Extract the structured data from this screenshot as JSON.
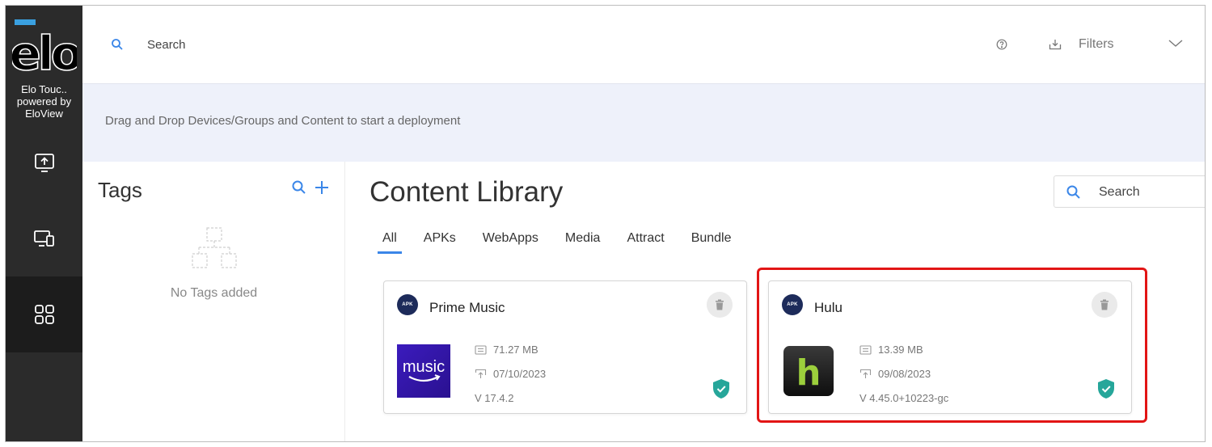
{
  "sidebar": {
    "brand_lines": [
      "Elo Touc..",
      "powered by",
      "EloView"
    ],
    "nav": [
      {
        "name": "deploy",
        "icon": "upload-screen-icon"
      },
      {
        "name": "devices",
        "icon": "devices-icon"
      },
      {
        "name": "content",
        "icon": "grid-icon",
        "active": true
      }
    ]
  },
  "topbar": {
    "search_placeholder": "Search",
    "filters_label": "Filters"
  },
  "banner": {
    "text": "Drag and Drop Devices/Groups and Content to start a deployment"
  },
  "tags": {
    "title": "Tags",
    "empty_text": "No Tags added"
  },
  "library": {
    "title": "Content Library",
    "search_placeholder": "Search",
    "tabs": [
      "All",
      "APKs",
      "WebApps",
      "Media",
      "Attract",
      "Bundle"
    ],
    "active_tab": "All",
    "cards": [
      {
        "badge": "APK",
        "name": "Prime Music",
        "size": "71.27 MB",
        "date": "07/10/2023",
        "version": "V 17.4.2",
        "icon": "amazon-music-icon",
        "icon_text": "music"
      },
      {
        "badge": "APK",
        "name": "Hulu",
        "size": "13.39 MB",
        "date": "09/08/2023",
        "version": "V 4.45.0+10223-gc",
        "icon": "hulu-icon",
        "icon_text": "h"
      }
    ]
  },
  "colors": {
    "sidebar": "#2b2b2b",
    "accent": "#3a86e8",
    "banner": "#eef1fa",
    "highlight": "#e21515",
    "verified": "#26a69a"
  }
}
